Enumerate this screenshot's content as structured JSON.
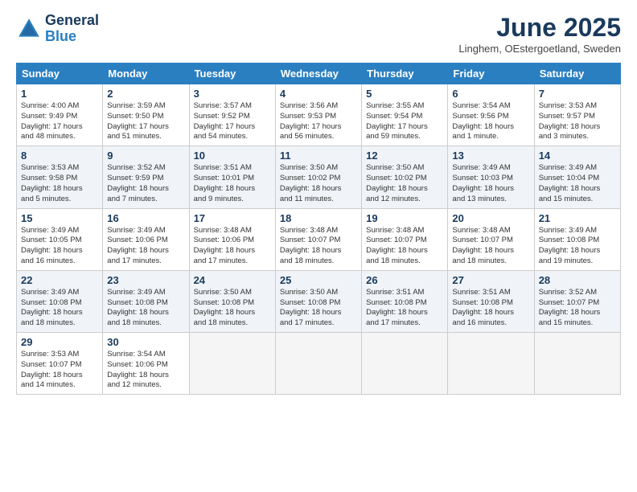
{
  "header": {
    "logo_line1": "General",
    "logo_line2": "Blue",
    "month_title": "June 2025",
    "subtitle": "Linghem, OEstergoetland, Sweden"
  },
  "weekdays": [
    "Sunday",
    "Monday",
    "Tuesday",
    "Wednesday",
    "Thursday",
    "Friday",
    "Saturday"
  ],
  "weeks": [
    [
      {
        "day": "1",
        "info": "Sunrise: 4:00 AM\nSunset: 9:49 PM\nDaylight: 17 hours\nand 48 minutes."
      },
      {
        "day": "2",
        "info": "Sunrise: 3:59 AM\nSunset: 9:50 PM\nDaylight: 17 hours\nand 51 minutes."
      },
      {
        "day": "3",
        "info": "Sunrise: 3:57 AM\nSunset: 9:52 PM\nDaylight: 17 hours\nand 54 minutes."
      },
      {
        "day": "4",
        "info": "Sunrise: 3:56 AM\nSunset: 9:53 PM\nDaylight: 17 hours\nand 56 minutes."
      },
      {
        "day": "5",
        "info": "Sunrise: 3:55 AM\nSunset: 9:54 PM\nDaylight: 17 hours\nand 59 minutes."
      },
      {
        "day": "6",
        "info": "Sunrise: 3:54 AM\nSunset: 9:56 PM\nDaylight: 18 hours\nand 1 minute."
      },
      {
        "day": "7",
        "info": "Sunrise: 3:53 AM\nSunset: 9:57 PM\nDaylight: 18 hours\nand 3 minutes."
      }
    ],
    [
      {
        "day": "8",
        "info": "Sunrise: 3:53 AM\nSunset: 9:58 PM\nDaylight: 18 hours\nand 5 minutes."
      },
      {
        "day": "9",
        "info": "Sunrise: 3:52 AM\nSunset: 9:59 PM\nDaylight: 18 hours\nand 7 minutes."
      },
      {
        "day": "10",
        "info": "Sunrise: 3:51 AM\nSunset: 10:01 PM\nDaylight: 18 hours\nand 9 minutes."
      },
      {
        "day": "11",
        "info": "Sunrise: 3:50 AM\nSunset: 10:02 PM\nDaylight: 18 hours\nand 11 minutes."
      },
      {
        "day": "12",
        "info": "Sunrise: 3:50 AM\nSunset: 10:02 PM\nDaylight: 18 hours\nand 12 minutes."
      },
      {
        "day": "13",
        "info": "Sunrise: 3:49 AM\nSunset: 10:03 PM\nDaylight: 18 hours\nand 13 minutes."
      },
      {
        "day": "14",
        "info": "Sunrise: 3:49 AM\nSunset: 10:04 PM\nDaylight: 18 hours\nand 15 minutes."
      }
    ],
    [
      {
        "day": "15",
        "info": "Sunrise: 3:49 AM\nSunset: 10:05 PM\nDaylight: 18 hours\nand 16 minutes."
      },
      {
        "day": "16",
        "info": "Sunrise: 3:49 AM\nSunset: 10:06 PM\nDaylight: 18 hours\nand 17 minutes."
      },
      {
        "day": "17",
        "info": "Sunrise: 3:48 AM\nSunset: 10:06 PM\nDaylight: 18 hours\nand 17 minutes."
      },
      {
        "day": "18",
        "info": "Sunrise: 3:48 AM\nSunset: 10:07 PM\nDaylight: 18 hours\nand 18 minutes."
      },
      {
        "day": "19",
        "info": "Sunrise: 3:48 AM\nSunset: 10:07 PM\nDaylight: 18 hours\nand 18 minutes."
      },
      {
        "day": "20",
        "info": "Sunrise: 3:48 AM\nSunset: 10:07 PM\nDaylight: 18 hours\nand 18 minutes."
      },
      {
        "day": "21",
        "info": "Sunrise: 3:49 AM\nSunset: 10:08 PM\nDaylight: 18 hours\nand 19 minutes."
      }
    ],
    [
      {
        "day": "22",
        "info": "Sunrise: 3:49 AM\nSunset: 10:08 PM\nDaylight: 18 hours\nand 18 minutes."
      },
      {
        "day": "23",
        "info": "Sunrise: 3:49 AM\nSunset: 10:08 PM\nDaylight: 18 hours\nand 18 minutes."
      },
      {
        "day": "24",
        "info": "Sunrise: 3:50 AM\nSunset: 10:08 PM\nDaylight: 18 hours\nand 18 minutes."
      },
      {
        "day": "25",
        "info": "Sunrise: 3:50 AM\nSunset: 10:08 PM\nDaylight: 18 hours\nand 17 minutes."
      },
      {
        "day": "26",
        "info": "Sunrise: 3:51 AM\nSunset: 10:08 PM\nDaylight: 18 hours\nand 17 minutes."
      },
      {
        "day": "27",
        "info": "Sunrise: 3:51 AM\nSunset: 10:08 PM\nDaylight: 18 hours\nand 16 minutes."
      },
      {
        "day": "28",
        "info": "Sunrise: 3:52 AM\nSunset: 10:07 PM\nDaylight: 18 hours\nand 15 minutes."
      }
    ],
    [
      {
        "day": "29",
        "info": "Sunrise: 3:53 AM\nSunset: 10:07 PM\nDaylight: 18 hours\nand 14 minutes."
      },
      {
        "day": "30",
        "info": "Sunrise: 3:54 AM\nSunset: 10:06 PM\nDaylight: 18 hours\nand 12 minutes."
      },
      null,
      null,
      null,
      null,
      null
    ]
  ]
}
